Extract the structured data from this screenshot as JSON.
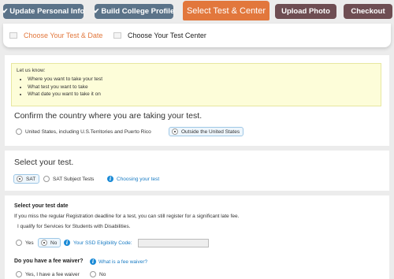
{
  "nav": {
    "steps": [
      {
        "label": "Update Personal Info",
        "state": "done"
      },
      {
        "label": "Build College Profile",
        "state": "done"
      },
      {
        "label": "Select Test & Center",
        "state": "active"
      },
      {
        "label": "Upload Photo",
        "state": "todo"
      },
      {
        "label": "Checkout",
        "state": "todo"
      }
    ],
    "check_glyph": "✔"
  },
  "substeps": [
    {
      "label": "Choose Your Test & Date",
      "active": true
    },
    {
      "label": "Choose Your Test Center",
      "active": false
    }
  ],
  "notice": {
    "intro": "Let us know:",
    "items": [
      "Where you want to take your test",
      "What test you want to take",
      "What date you want to take it on"
    ]
  },
  "country": {
    "heading": "Confirm the country where you are taking your test.",
    "options": [
      {
        "label": "United States, including U.S.Territories and Puerto Rico",
        "selected": false
      },
      {
        "label": "Outside the United States",
        "selected": true
      }
    ]
  },
  "test": {
    "heading": "Select your test.",
    "options": [
      {
        "label": "SAT",
        "selected": true
      },
      {
        "label": "SAT Subject Tests",
        "selected": false
      }
    ],
    "help_link": "Choosing your test"
  },
  "date": {
    "heading": "Select your test date",
    "note": "If you miss the regular Registration deadline for a test, you can still register for a significant late fee.",
    "ssd_question": "I qualify for Services for Students with Disabilities.",
    "ssd_options": [
      {
        "label": "Yes",
        "selected": false
      },
      {
        "label": "No",
        "selected": true
      }
    ],
    "ssd_code_label": "Your SSD Eligibility Code:",
    "ssd_code_value": ""
  },
  "waiver": {
    "heading": "Do you have a fee waiver?",
    "help_link": "What is a fee waiver?",
    "options": [
      {
        "label": "Yes, I have a fee waiver",
        "selected": false
      },
      {
        "label": "No",
        "selected": false
      }
    ]
  },
  "colors": {
    "active_step": "#e2773c",
    "done_step": "#5b7389",
    "todo_step": "#6e4d52",
    "link": "#1a7cc4",
    "notice_bg": "#fdfdd9"
  }
}
